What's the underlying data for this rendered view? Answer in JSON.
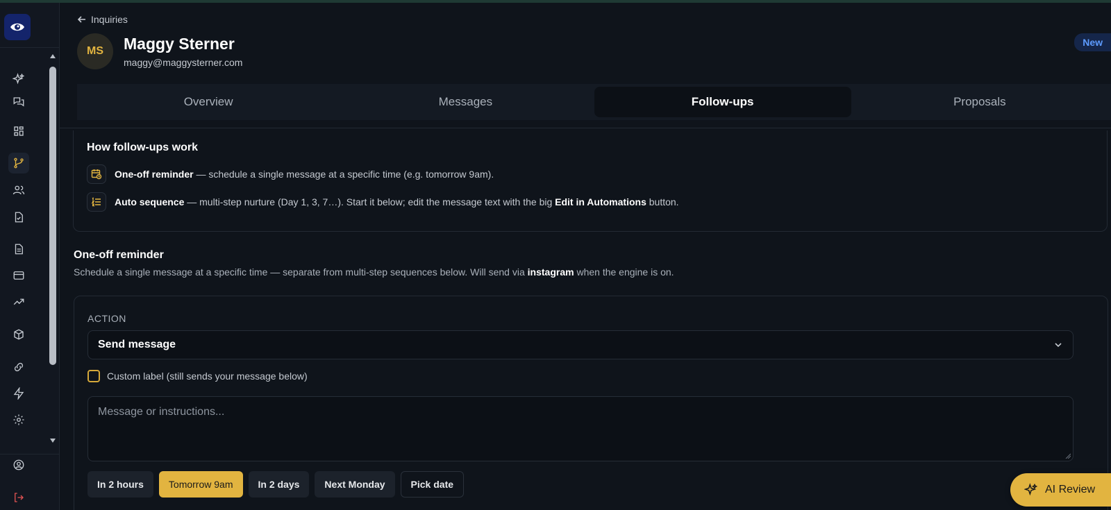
{
  "header": {
    "back_label": "Inquiries",
    "avatar_initials": "MS",
    "name": "Maggy Sterner",
    "email": "maggy@maggysterner.com",
    "status_badge": "New"
  },
  "tabs": [
    {
      "label": "Overview"
    },
    {
      "label": "Messages"
    },
    {
      "label": "Follow-ups",
      "active": true
    },
    {
      "label": "Proposals"
    }
  ],
  "info": {
    "title": "How follow-ups work",
    "oneoff_bold": "One-off reminder",
    "oneoff_text": " — schedule a single message at a specific time (e.g. tomorrow 9am).",
    "auto_bold": "Auto sequence",
    "auto_text_1": " — multi-step nurture (Day 1, 3, 7…). Start it below; edit the message text with the big ",
    "auto_link": "Edit in Automations",
    "auto_text_2": " button."
  },
  "oneoff": {
    "title": "One-off reminder",
    "desc_1": "Schedule a single message at a specific time — separate from multi-step sequences below. Will send via ",
    "desc_channel": "instagram",
    "desc_2": " when the engine is on.",
    "action_label": "ACTION",
    "action_value": "Send message",
    "custom_label": "Custom label (still sends your message below)",
    "message_placeholder": "Message or instructions...",
    "quick_options": [
      "In 2 hours",
      "Tomorrow 9am",
      "In 2 days",
      "Next Monday",
      "Pick date"
    ],
    "selected_option": "Tomorrow 9am"
  },
  "ai_review_label": "AI Review",
  "colors": {
    "accent": "#e2b440",
    "background": "#0f141b",
    "badge_text": "#5d9bff"
  },
  "sidebar_icons": [
    "sparkle-icon",
    "chat-icon",
    "grid-icon",
    "branch-icon",
    "users-icon",
    "file-check-icon",
    "document-icon",
    "card-icon",
    "trend-icon",
    "box-icon",
    "link-icon",
    "bolt-icon",
    "gear-icon",
    "user-circle-icon",
    "logout-icon"
  ]
}
